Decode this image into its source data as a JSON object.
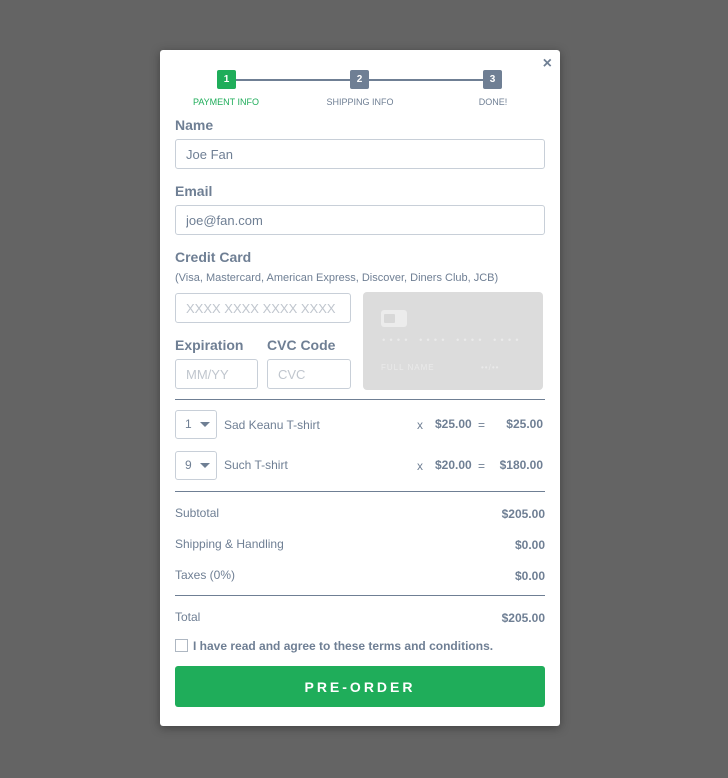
{
  "modal": {
    "close_glyph": "×"
  },
  "stepper": {
    "steps": [
      {
        "number": "1",
        "label": "PAYMENT INFO",
        "active": true
      },
      {
        "number": "2",
        "label": "SHIPPING INFO",
        "active": false
      },
      {
        "number": "3",
        "label": "DONE!",
        "active": false
      }
    ],
    "active_color": "#1fad5a",
    "inactive_color": "#6f7f94"
  },
  "form": {
    "name_label": "Name",
    "name_value": "Joe Fan",
    "email_label": "Email",
    "email_value": "joe@fan.com",
    "card_label": "Credit Card",
    "card_accepted": "(Visa, Mastercard, American Express, Discover, Diners Club, JCB)",
    "card_placeholder": "XXXX XXXX XXXX XXXX",
    "expiration_label": "Expiration",
    "expiration_placeholder": "MM/YY",
    "cvc_label": "CVC Code",
    "cvc_placeholder": "CVC"
  },
  "card_preview": {
    "number": "•••• •••• •••• ••••",
    "name": "FULL NAME",
    "expiry": "••/••"
  },
  "items": [
    {
      "qty": "1",
      "name": "Sad Keanu T-shirt",
      "times": "x",
      "price": "$25.00",
      "equals": "=",
      "total": "$25.00"
    },
    {
      "qty": "9",
      "name": "Such T-shirt",
      "times": "x",
      "price": "$20.00",
      "equals": "=",
      "total": "$180.00"
    }
  ],
  "summary": {
    "subtotal_label": "Subtotal",
    "subtotal_value": "$205.00",
    "shipping_label": "Shipping & Handling",
    "shipping_value": "$0.00",
    "taxes_label": "Taxes (0%)",
    "taxes_value": "$0.00",
    "total_label": "Total",
    "total_value": "$205.00"
  },
  "terms_text": "I have read and agree to these terms and conditions.",
  "preorder_label": "PRE-ORDER",
  "colors": {
    "backdrop": "#646464",
    "accent": "#1fad5a",
    "text": "#6f7f94"
  }
}
